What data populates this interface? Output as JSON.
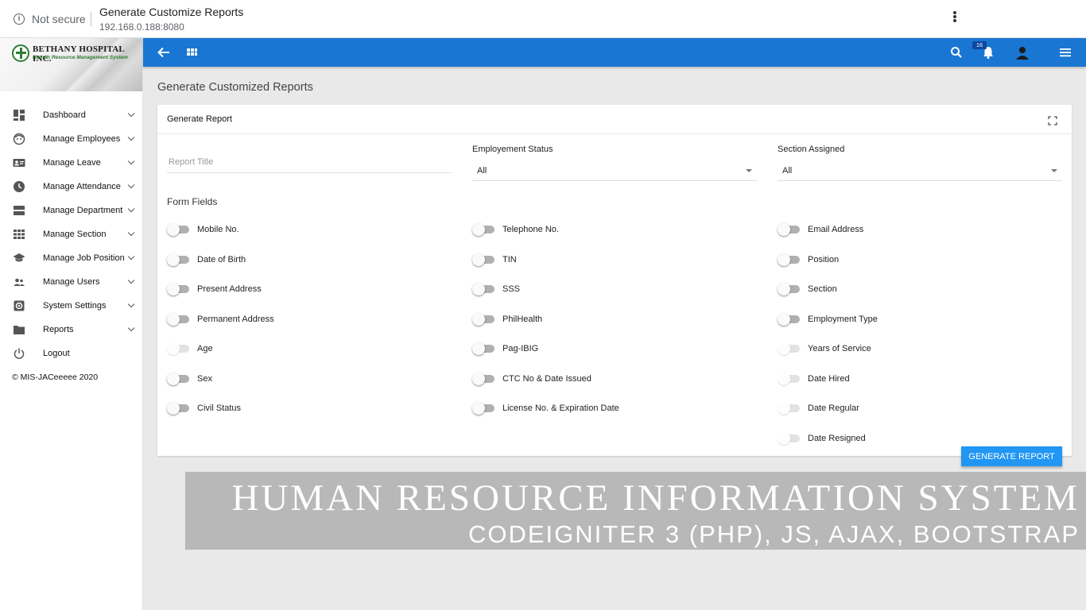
{
  "browser": {
    "security_label": "Not secure",
    "tab_title": "Generate Customize Reports",
    "url": "192.168.0.188:8080"
  },
  "brand": {
    "name": "BETHANY HOSPITAL INC.",
    "tagline": "Human Resource Management System"
  },
  "sidebar": {
    "items": [
      {
        "label": "Dashboard",
        "icon": "dashboard-icon"
      },
      {
        "label": "Manage Employees",
        "icon": "face-icon"
      },
      {
        "label": "Manage Leave",
        "icon": "id-card-icon"
      },
      {
        "label": "Manage Attendance",
        "icon": "clock-icon"
      },
      {
        "label": "Manage Department",
        "icon": "list-icon"
      },
      {
        "label": "Manage Section",
        "icon": "grid-icon"
      },
      {
        "label": "Manage Job Position",
        "icon": "school-icon"
      },
      {
        "label": "Manage Users",
        "icon": "people-icon"
      },
      {
        "label": "System Settings",
        "icon": "settings-icon"
      },
      {
        "label": "Reports",
        "icon": "folder-icon"
      },
      {
        "label": "Logout",
        "icon": "power-icon"
      }
    ],
    "copyright": "© MIS-JACeeeee 2020"
  },
  "topbar": {
    "notification_count": "16",
    "color": "#1976d2"
  },
  "page": {
    "title": "Generate Customized Reports"
  },
  "card": {
    "title": "Generate Report",
    "report_title_placeholder": "Report Title",
    "employment_status": {
      "label": "Employement Status",
      "value": "All"
    },
    "section_assigned": {
      "label": "Section Assigned",
      "value": "All"
    },
    "form_fields_heading": "Form Fields",
    "col1": [
      {
        "label": "Mobile No.",
        "enabled": true
      },
      {
        "label": "Date of Birth",
        "enabled": true
      },
      {
        "label": "Present Address",
        "enabled": true
      },
      {
        "label": "Permanent Address",
        "enabled": true
      },
      {
        "label": "Age",
        "enabled": false
      },
      {
        "label": "Sex",
        "enabled": true
      },
      {
        "label": "Civil Status",
        "enabled": true
      }
    ],
    "col2": [
      {
        "label": "Telephone No.",
        "enabled": true
      },
      {
        "label": "TIN",
        "enabled": true
      },
      {
        "label": "SSS",
        "enabled": true
      },
      {
        "label": "PhilHealth",
        "enabled": true
      },
      {
        "label": "Pag-IBIG",
        "enabled": true
      },
      {
        "label": "CTC No & Date Issued",
        "enabled": true
      },
      {
        "label": "License No. & Expiration Date",
        "enabled": true
      }
    ],
    "col3": [
      {
        "label": "Email Address",
        "enabled": true
      },
      {
        "label": "Position",
        "enabled": true
      },
      {
        "label": "Section",
        "enabled": true
      },
      {
        "label": "Employment Type",
        "enabled": true
      },
      {
        "label": "Years of Service",
        "enabled": false
      },
      {
        "label": "Date Hired",
        "enabled": false
      },
      {
        "label": "Date Regular",
        "enabled": false
      },
      {
        "label": "Date Resigned",
        "enabled": false
      }
    ],
    "generate_button": "GENERATE REPORT",
    "button_color": "#2196f3"
  },
  "banner": {
    "line1": "HUMAN RESOURCE INFORMATION SYSTEM",
    "line2": "CODEIGNITER 3 (PHP), JS, AJAX, BOOTSTRAP"
  }
}
